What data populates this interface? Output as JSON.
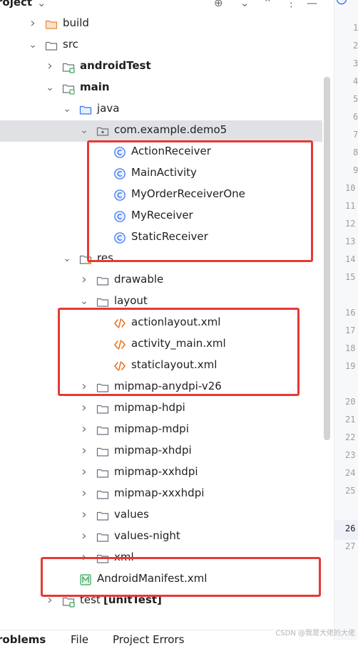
{
  "header": {
    "title": "roject"
  },
  "tree": [
    {
      "label": "build",
      "icon": "folder-orange-icon"
    },
    {
      "label": "src",
      "icon": "folder-icon"
    },
    {
      "label": "androidTest",
      "icon": "test-folder-icon"
    },
    {
      "label": "main",
      "icon": "module-folder-icon"
    },
    {
      "label": "java",
      "icon": "source-folder-icon"
    },
    {
      "label": "com.example.demo5",
      "icon": "package-icon"
    },
    {
      "label": "ActionReceiver",
      "icon": "class-icon"
    },
    {
      "label": "MainActivity",
      "icon": "class-icon"
    },
    {
      "label": "MyOrderReceiverOne",
      "icon": "class-icon"
    },
    {
      "label": "MyReceiver",
      "icon": "class-icon"
    },
    {
      "label": "StaticReceiver",
      "icon": "class-icon"
    },
    {
      "label": "res",
      "icon": "resource-folder-icon"
    },
    {
      "label": "drawable",
      "icon": "folder-icon"
    },
    {
      "label": "layout",
      "icon": "folder-icon"
    },
    {
      "label": "actionlayout.xml",
      "icon": "xml-file-icon"
    },
    {
      "label": "activity_main.xml",
      "icon": "xml-file-icon"
    },
    {
      "label": "staticlayout.xml",
      "icon": "xml-file-icon"
    },
    {
      "label": "mipmap-anydpi-v26",
      "icon": "folder-icon"
    },
    {
      "label": "mipmap-hdpi",
      "icon": "folder-icon"
    },
    {
      "label": "mipmap-mdpi",
      "icon": "folder-icon"
    },
    {
      "label": "mipmap-xhdpi",
      "icon": "folder-icon"
    },
    {
      "label": "mipmap-xxhdpi",
      "icon": "folder-icon"
    },
    {
      "label": "mipmap-xxxhdpi",
      "icon": "folder-icon"
    },
    {
      "label": "values",
      "icon": "folder-icon"
    },
    {
      "label": "values-night",
      "icon": "folder-icon"
    },
    {
      "label": "xml",
      "icon": "folder-icon"
    },
    {
      "label": "AndroidManifest.xml",
      "icon": "manifest-file-icon"
    },
    {
      "label": "test",
      "suffix": "[unitTest]",
      "icon": "test-folder-icon"
    }
  ],
  "gutter": {
    "lines": [
      "1",
      "2",
      "3",
      "4",
      "5",
      "6",
      "7",
      "8",
      "9",
      "10",
      "11",
      "12",
      "13",
      "14",
      "15",
      "16",
      "17",
      "18",
      "19",
      "20",
      "21",
      "22",
      "23",
      "24",
      "25",
      "26",
      "27"
    ],
    "current": "26"
  },
  "bottom_tabs": [
    "roblems",
    "File",
    "Project Errors"
  ],
  "watermark": "CSDN @我是大佬的大佬",
  "colors": {
    "highlight_box": "#e53935",
    "selected_row": "#dfe1e5",
    "class_icon": "#3574f0",
    "xml_icon": "#e66d17",
    "manifest_icon": "#3aa55d"
  }
}
